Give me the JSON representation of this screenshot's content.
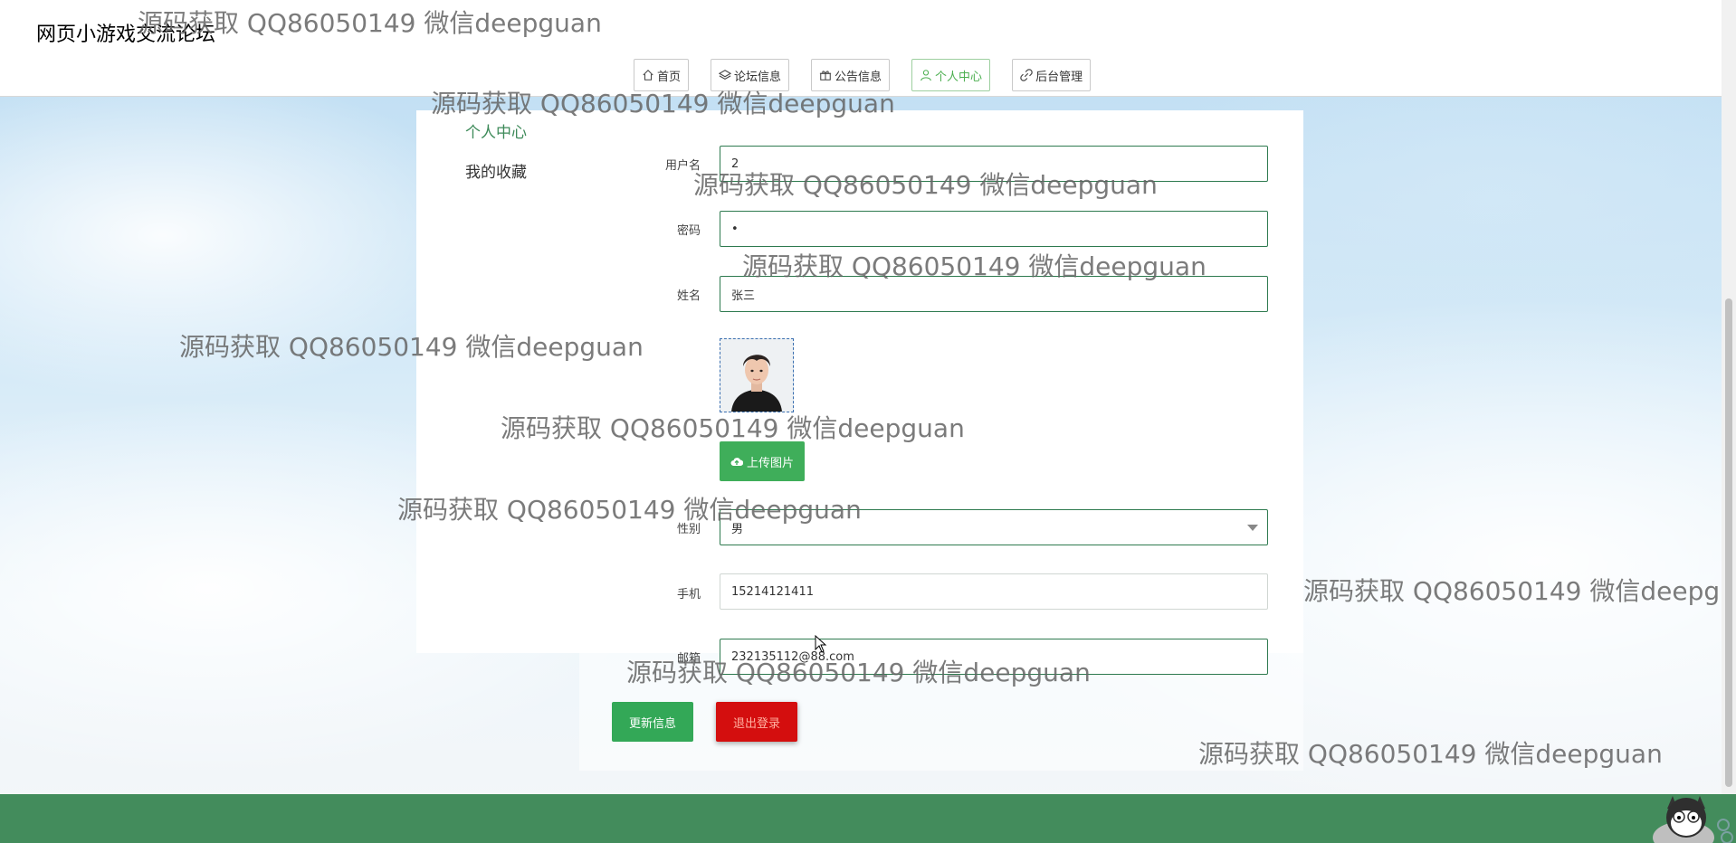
{
  "header": {
    "site_title": "网页小游戏交流论坛",
    "nav": [
      {
        "label": "首页",
        "icon": "home-icon",
        "active": false
      },
      {
        "label": "论坛信息",
        "icon": "layers-icon",
        "active": false
      },
      {
        "label": "公告信息",
        "icon": "gift-icon",
        "active": false
      },
      {
        "label": "个人中心",
        "icon": "user-icon",
        "active": true
      },
      {
        "label": "后台管理",
        "icon": "link-icon",
        "active": false
      }
    ]
  },
  "sidebar": {
    "items": [
      {
        "label": "个人中心",
        "active": true
      },
      {
        "label": "我的收藏",
        "active": false
      }
    ]
  },
  "form": {
    "username": {
      "label": "用户名",
      "value": "2"
    },
    "password": {
      "label": "密码",
      "value": "•"
    },
    "name": {
      "label": "姓名",
      "value": "张三"
    },
    "upload_label": "上传图片",
    "gender": {
      "label": "性别",
      "value": "男"
    },
    "phone": {
      "label": "手机",
      "value": "15214121411"
    },
    "email": {
      "label": "邮箱",
      "value": "232135112@88.com"
    }
  },
  "actions": {
    "update_label": "更新信息",
    "logout_label": "退出登录"
  },
  "watermark_text": "源码获取 QQ86050149 微信deepguan",
  "watermark_text_cut": "源码获取 QQ86050149 微信deepg",
  "colors": {
    "accent_green": "#3fae5a",
    "footer_green": "#438c5c",
    "danger_red": "#d40e0e"
  }
}
